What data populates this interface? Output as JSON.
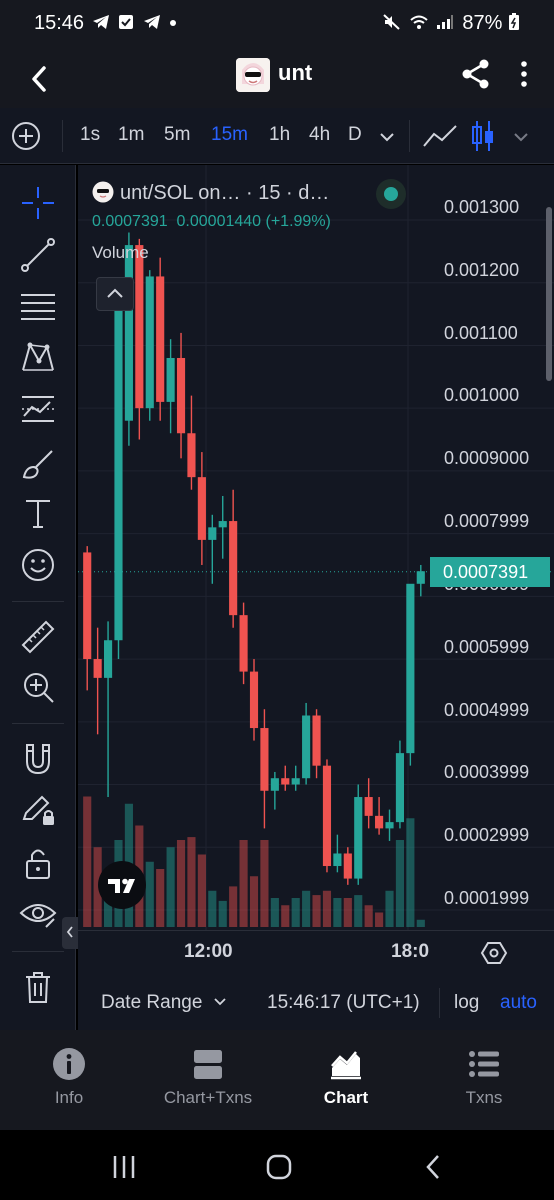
{
  "status_bar": {
    "time": "15:46",
    "battery": "87%",
    "left_icons": [
      "telegram-icon",
      "checkbox-icon",
      "telegram-icon",
      "dot-icon"
    ],
    "right_icons": [
      "mute-icon",
      "wifi-icon",
      "signal-icon",
      "battery-icon"
    ]
  },
  "header": {
    "title": "unt"
  },
  "toolbar": {
    "timeframes": [
      "1s",
      "1m",
      "5m",
      "15m",
      "1h",
      "4h",
      "D"
    ],
    "active_timeframe": "15m"
  },
  "legend": {
    "symbol": "unt/SOL on…",
    "interval": "· 15 · d…",
    "last_price": "0.0007391",
    "change": "0.00001440 (+1.99%)",
    "volume_label": "Volume"
  },
  "price_axis": {
    "labels": [
      "0.001300",
      "0.001200",
      "0.001100",
      "0.001000",
      "0.0009000",
      "0.0007999",
      "0.0006999",
      "0.0005999",
      "0.0004999",
      "0.0003999",
      "0.0002999",
      "0.0001999"
    ],
    "current_price_tag": "0.0007391"
  },
  "time_axis": {
    "labels": [
      "12:00",
      "18:0"
    ]
  },
  "bottom_bar": {
    "date_range": "Date Range",
    "clock": "15:46:17 (UTC+1)",
    "log": "log",
    "auto": "auto"
  },
  "nav": {
    "items": [
      {
        "label": "Info",
        "icon": "info-icon"
      },
      {
        "label": "Chart+Txns",
        "icon": "split-view-icon"
      },
      {
        "label": "Chart",
        "icon": "chart-icon"
      },
      {
        "label": "Txns",
        "icon": "list-icon"
      }
    ],
    "active": "Chart"
  },
  "colors": {
    "up": "#26a69a",
    "down": "#ef5350",
    "accent": "#2962ff",
    "background": "#131722"
  },
  "chart_data": {
    "type": "candlestick",
    "pair": "unt/SOL",
    "interval": "15",
    "ylim": [
      0.00018,
      0.00135
    ],
    "y_ticks": [
      0.0013,
      0.0012,
      0.0011,
      0.001,
      0.0009,
      0.0007999,
      0.0006999,
      0.0005999,
      0.0004999,
      0.0003999,
      0.0002999,
      0.0001999
    ],
    "x_ticks": [
      "12:00",
      "18:0"
    ],
    "last_price": 0.0007391,
    "candles": [
      {
        "o": 0.00077,
        "h": 0.00078,
        "l": 0.00055,
        "c": 0.0006
      },
      {
        "o": 0.0006,
        "h": 0.00065,
        "l": 0.00048,
        "c": 0.00057
      },
      {
        "o": 0.00057,
        "h": 0.00066,
        "l": 0.00038,
        "c": 0.00063
      },
      {
        "o": 0.00063,
        "h": 0.0012,
        "l": 0.0006,
        "c": 0.00119
      },
      {
        "o": 0.00098,
        "h": 0.00128,
        "l": 0.00094,
        "c": 0.00126
      },
      {
        "o": 0.00126,
        "h": 0.00127,
        "l": 0.00095,
        "c": 0.001
      },
      {
        "o": 0.001,
        "h": 0.00122,
        "l": 0.00098,
        "c": 0.00121
      },
      {
        "o": 0.00121,
        "h": 0.00124,
        "l": 0.00098,
        "c": 0.00101
      },
      {
        "o": 0.00101,
        "h": 0.00111,
        "l": 0.00096,
        "c": 0.00108
      },
      {
        "o": 0.00108,
        "h": 0.00112,
        "l": 0.00092,
        "c": 0.00096
      },
      {
        "o": 0.00096,
        "h": 0.00102,
        "l": 0.00087,
        "c": 0.00089
      },
      {
        "o": 0.00089,
        "h": 0.00093,
        "l": 0.00075,
        "c": 0.00079
      },
      {
        "o": 0.00079,
        "h": 0.00083,
        "l": 0.00072,
        "c": 0.00081
      },
      {
        "o": 0.00081,
        "h": 0.00086,
        "l": 0.00076,
        "c": 0.00082
      },
      {
        "o": 0.00082,
        "h": 0.00087,
        "l": 0.00065,
        "c": 0.00067
      },
      {
        "o": 0.00067,
        "h": 0.00069,
        "l": 0.00056,
        "c": 0.00058
      },
      {
        "o": 0.00058,
        "h": 0.0006,
        "l": 0.00047,
        "c": 0.00049
      },
      {
        "o": 0.00049,
        "h": 0.00052,
        "l": 0.00033,
        "c": 0.00039
      },
      {
        "o": 0.00039,
        "h": 0.00042,
        "l": 0.00036,
        "c": 0.00041
      },
      {
        "o": 0.00041,
        "h": 0.00043,
        "l": 0.00039,
        "c": 0.0004
      },
      {
        "o": 0.0004,
        "h": 0.00043,
        "l": 0.00039,
        "c": 0.00041
      },
      {
        "o": 0.00041,
        "h": 0.00053,
        "l": 0.0004,
        "c": 0.00051
      },
      {
        "o": 0.00051,
        "h": 0.00052,
        "l": 0.00041,
        "c": 0.00043
      },
      {
        "o": 0.00043,
        "h": 0.00044,
        "l": 0.00026,
        "c": 0.00027
      },
      {
        "o": 0.00027,
        "h": 0.00032,
        "l": 0.00026,
        "c": 0.00029
      },
      {
        "o": 0.00029,
        "h": 0.0003,
        "l": 0.00024,
        "c": 0.00025
      },
      {
        "o": 0.00025,
        "h": 0.0004,
        "l": 0.00024,
        "c": 0.00038
      },
      {
        "o": 0.00038,
        "h": 0.00041,
        "l": 0.00033,
        "c": 0.00035
      },
      {
        "o": 0.00035,
        "h": 0.00038,
        "l": 0.00032,
        "c": 0.00033
      },
      {
        "o": 0.00033,
        "h": 0.00036,
        "l": 0.00031,
        "c": 0.00034
      },
      {
        "o": 0.00034,
        "h": 0.00047,
        "l": 0.00033,
        "c": 0.00045
      },
      {
        "o": 0.00045,
        "h": 0.0007,
        "l": 0.00043,
        "c": 0.00072
      },
      {
        "o": 0.00072,
        "h": 0.00075,
        "l": 0.0007,
        "c": 0.00074
      }
    ],
    "volume": [
      0.9,
      0.55,
      0.35,
      0.6,
      0.85,
      0.7,
      0.45,
      0.4,
      0.55,
      0.6,
      0.62,
      0.5,
      0.25,
      0.18,
      0.28,
      0.6,
      0.35,
      0.6,
      0.2,
      0.15,
      0.2,
      0.25,
      0.22,
      0.25,
      0.2,
      0.2,
      0.22,
      0.15,
      0.1,
      0.25,
      0.6,
      0.75,
      0.05
    ]
  }
}
